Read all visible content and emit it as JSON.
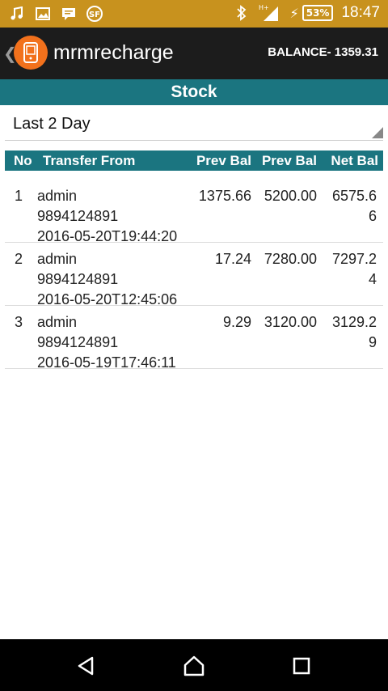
{
  "status_bar": {
    "battery_percent": "53%",
    "time": "18:47",
    "network_label": "H+",
    "icons": [
      "music-icon",
      "image-icon",
      "message-icon",
      "sf-icon",
      "bluetooth-icon",
      "signal-icon",
      "charging-icon",
      "battery-icon"
    ]
  },
  "action_bar": {
    "title": "mrmrecharge",
    "balance": "BALANCE- 1359.31",
    "back_icon": "chevron-left-icon",
    "logo_icon": "phone-icon"
  },
  "section": {
    "title": "Stock"
  },
  "filter": {
    "selected": "Last 2 Day"
  },
  "table": {
    "headers": [
      "No",
      "Transfer From",
      "Prev Bal",
      "Prev Bal",
      "Net Bal"
    ],
    "rows": [
      {
        "no": "1",
        "from_name": "admin",
        "from_phone": "9894124891",
        "from_time": "2016-05-20T19:44:20",
        "prev_bal_1": "1375.66",
        "prev_bal_2": "5200.00",
        "net_bal": "6575.66"
      },
      {
        "no": "2",
        "from_name": "admin",
        "from_phone": "9894124891",
        "from_time": "2016-05-20T12:45:06",
        "prev_bal_1": "17.24",
        "prev_bal_2": "7280.00",
        "net_bal": "7297.24"
      },
      {
        "no": "3",
        "from_name": "admin",
        "from_phone": "9894124891",
        "from_time": "2016-05-19T17:46:11",
        "prev_bal_1": "9.29",
        "prev_bal_2": "3120.00",
        "net_bal": "3129.29"
      }
    ]
  },
  "colors": {
    "status_bar": "#c8921e",
    "action_bar": "#1c1c1c",
    "teal": "#1b7580",
    "logo": "#f2711c"
  },
  "nav": {
    "icons": [
      "back-icon",
      "home-icon",
      "recents-icon"
    ]
  }
}
